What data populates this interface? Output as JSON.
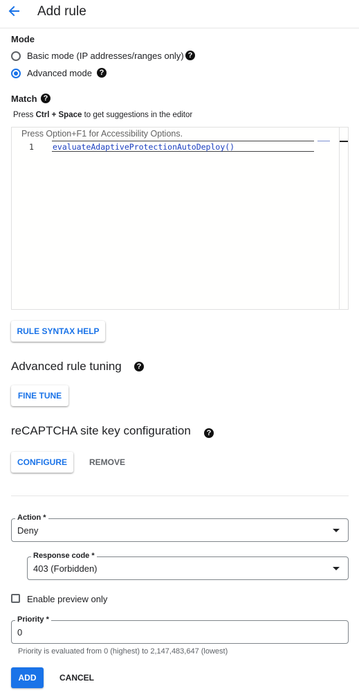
{
  "header": {
    "title": "Add rule"
  },
  "mode": {
    "label": "Mode",
    "options": [
      {
        "label": "Basic mode (IP addresses/ranges only)",
        "selected": false
      },
      {
        "label": "Advanced mode",
        "selected": true
      }
    ]
  },
  "match": {
    "label": "Match",
    "hint_prefix": "Press ",
    "hint_keys": "Ctrl + Space",
    "hint_suffix": " to get suggestions in the editor",
    "editor": {
      "accessibility_text": "Press Option+F1 for Accessibility Options.",
      "line_number": "1",
      "code": "evaluateAdaptiveProtectionAutoDeploy()"
    },
    "syntax_help_button": "RULE SYNTAX HELP"
  },
  "tuning": {
    "title": "Advanced rule tuning",
    "button": "FINE TUNE"
  },
  "recaptcha": {
    "title": "reCAPTCHA site key configuration",
    "configure_button": "CONFIGURE",
    "remove_button": "REMOVE"
  },
  "action": {
    "label": "Action *",
    "value": "Deny"
  },
  "response_code": {
    "label": "Response code *",
    "value": "403 (Forbidden)"
  },
  "preview": {
    "label": "Enable preview only",
    "checked": false
  },
  "priority": {
    "label": "Priority *",
    "value": "0",
    "helper": "Priority is evaluated from 0 (highest) to 2,147,483,647 (lowest)"
  },
  "footer": {
    "add_button": "ADD",
    "cancel_button": "CANCEL"
  },
  "colors": {
    "accent": "#1a73e8",
    "text": "#202124",
    "muted": "#5f6368"
  }
}
